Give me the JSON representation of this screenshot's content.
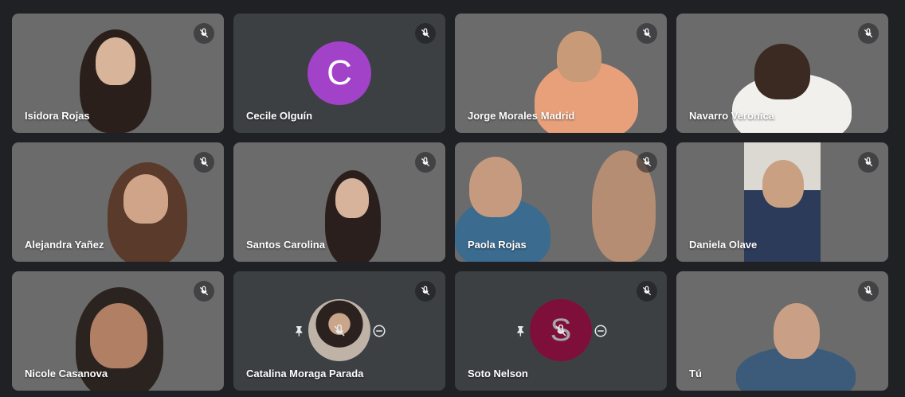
{
  "participants": [
    {
      "name": "Isidora Rojas",
      "type": "video",
      "muted": true
    },
    {
      "name": "Cecile Olguín",
      "type": "avatar",
      "initial": "C",
      "muted": true
    },
    {
      "name": "Jorge Morales Madrid",
      "type": "video",
      "muted": true
    },
    {
      "name": "Navarro Veronica",
      "type": "video",
      "muted": true
    },
    {
      "name": "Alejandra Yañez",
      "type": "video",
      "muted": true
    },
    {
      "name": "Santos Carolina",
      "type": "video",
      "muted": true
    },
    {
      "name": "Paola Rojas",
      "type": "video",
      "muted": true
    },
    {
      "name": "Daniela Olave",
      "type": "video",
      "muted": true
    },
    {
      "name": "Nicole Casanova",
      "type": "video",
      "muted": true
    },
    {
      "name": "Catalina Moraga Parada",
      "type": "avatar-photo",
      "muted": true
    },
    {
      "name": "Soto Nelson",
      "type": "avatar",
      "initial": "S",
      "muted": true
    },
    {
      "name": "Tú",
      "type": "video",
      "muted": true
    }
  ],
  "colors": {
    "background": "#202124",
    "tile": "#3c4043",
    "avatar_c": "#a142c9",
    "avatar_s": "#c2185b"
  },
  "icons": {
    "mute": "mic-off-icon",
    "pin": "pin-icon",
    "remove": "remove-icon"
  }
}
